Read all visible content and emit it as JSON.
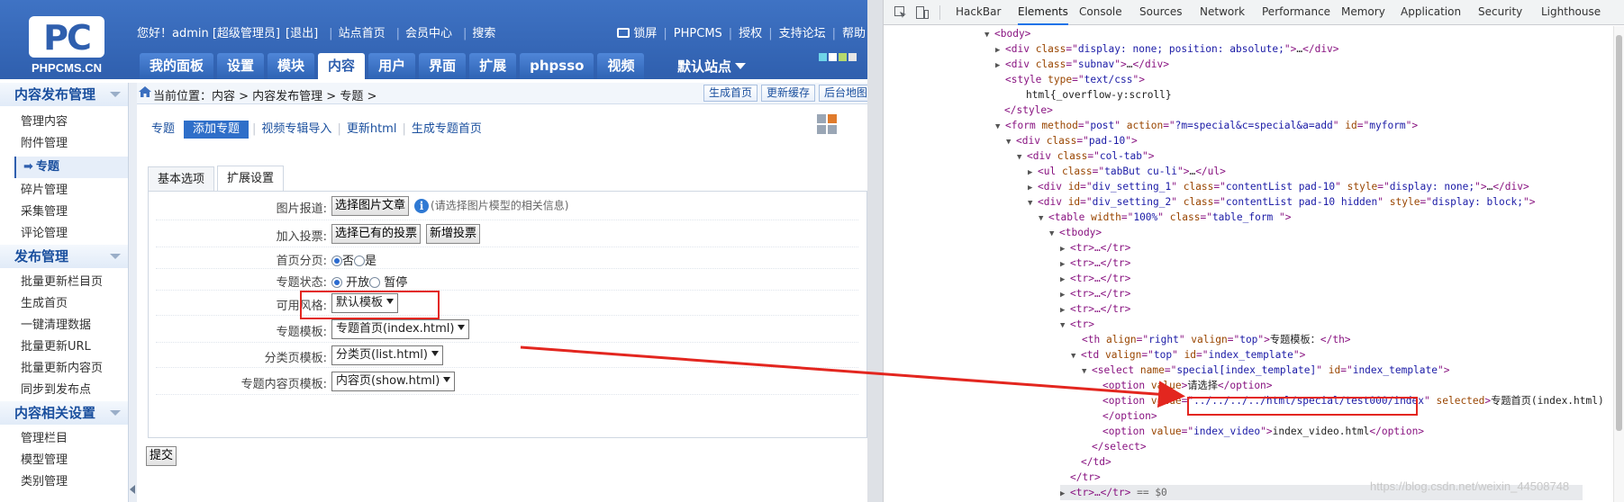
{
  "cms": {
    "logo": {
      "letters": "PC",
      "name": "PHPCMS.CN"
    },
    "topbar": {
      "greeting": "您好！admin [超级管理员]",
      "logout": "[退出]",
      "site_home": "站点首页",
      "member_center": "会员中心",
      "search": "搜索"
    },
    "topright": {
      "lock": "锁屏",
      "phpcms": "PHPCMS",
      "license": "授权",
      "forum": "支持论坛",
      "help": "帮助"
    },
    "nav": [
      {
        "label": "我的面板"
      },
      {
        "label": "设置"
      },
      {
        "label": "模块"
      },
      {
        "label": "内容",
        "active": true
      },
      {
        "label": "用户"
      },
      {
        "label": "界面"
      },
      {
        "label": "扩展"
      },
      {
        "label": "phpsso"
      },
      {
        "label": "视频"
      }
    ],
    "site_select": "默认站点",
    "skin_colors": [
      "#6fd4e8",
      "#ffffff",
      "#b6d96e",
      "#e6e6e6"
    ],
    "sidebar": {
      "group1": "内容发布管理",
      "items1": [
        "管理内容",
        "附件管理",
        "专题",
        "碎片管理",
        "采集管理",
        "评论管理"
      ],
      "group2": "发布管理",
      "items2": [
        "批量更新栏目页",
        "生成首页",
        "一键清理数据",
        "批量更新URL",
        "批量更新内容页",
        "同步到发布点"
      ],
      "group3": "内容相关设置",
      "items3": [
        "管理栏目",
        "模型管理",
        "类别管理"
      ]
    },
    "crumb": "当前位置：内容 > 内容发布管理 > 专题 >",
    "crumb_buttons": [
      "生成首页",
      "更新缓存",
      "后台地图"
    ],
    "subnav": [
      "专题",
      "添加专题",
      "视频专辑导入",
      "更新html",
      "生成专题首页"
    ],
    "tabs": [
      "基本选项",
      "扩展设置"
    ],
    "form": {
      "pic_label": "图片报道:",
      "pic_button": "选择图片文章",
      "pic_hint": "(请选择图片模型的相关信息)",
      "vote_label": "加入投票:",
      "vote_button1": "选择已有的投票",
      "vote_button2": "新增投票",
      "paging_label": "首页分页:",
      "paging_no": "否",
      "paging_yes": "是",
      "status_label": "专题状态:",
      "status_open": "开放",
      "status_pause": "暂停",
      "style_label": "可用风格:",
      "style_value": "默认模板",
      "template_label": "专题模板:",
      "template_value": "专题首页(index.html)",
      "list_label": "分类页模板:",
      "list_value": "分类页(list.html)",
      "show_label": "专题内容页模板:",
      "show_value": "内容页(show.html)",
      "submit": "提交"
    }
  },
  "devtools": {
    "tabs": [
      "HackBar",
      "Elements",
      "Console",
      "Sources",
      "Network",
      "Performance",
      "Memory",
      "Application",
      "Security",
      "Lighthouse"
    ],
    "active_tab": "Elements",
    "lines": {
      "l0": "<body>",
      "l1a": "<div ",
      "l1b": "class",
      "l1c": "=\"",
      "l1d": "display: none; position: absolute;",
      "l1e": "\">",
      "l1f": "…",
      "l1g": "</div>",
      "l2": "subnav",
      "l3": "text/css",
      "l4": "html{_overflow-y:scroll}",
      "l5": "</style>",
      "l6_method": "post",
      "l6_action": "?m=special&c=special&a=add",
      "l6_id": "myform",
      "l7": "pad-10",
      "l8": "col-tab",
      "l9": "tabBut cu-li",
      "l10_id": "div_setting_1",
      "l10_class": "contentList pad-10",
      "l10_style": "display: none;",
      "l11_id": "div_setting_2",
      "l11_class": "contentList pad-10 hidden",
      "l11_style": "display: block;",
      "l12_width": "100%",
      "l12_class": "table_form ",
      "l13": "<tbody>",
      "tr_collapsed": "<tr>…</tr>",
      "tr_open": "<tr>",
      "th_align": "right",
      "th_valign": "top",
      "th_text": "专题模板：",
      "td_valign": "top",
      "td_id": "index_template",
      "select_name": "special[index_template]",
      "select_id": "index_template",
      "opt1_text": "请选择",
      "opt2_value": "../../../../html/special/test000/index",
      "opt2_text": "专题首页(index.html)",
      "opt3_value": "index_video",
      "opt3_text": "index_video.html",
      "last_tr": "<tr>…</tr>",
      "last_marker": "== $0"
    }
  },
  "watermark": "https://blog.csdn.net/weixin_44508748",
  "colors": {
    "header_blue": "#2f5fae",
    "highlight_red": "#e3261f",
    "devtools_tag": "#881280",
    "devtools_attr": "#994500",
    "devtools_value": "#1a1aa6"
  }
}
